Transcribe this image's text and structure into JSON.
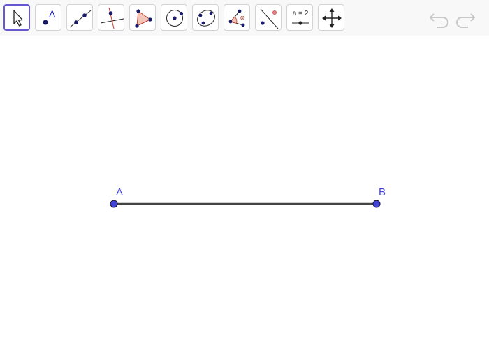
{
  "toolbar": {
    "tools": [
      {
        "name": "move-tool",
        "selected": true
      },
      {
        "name": "point-tool",
        "label": "A"
      },
      {
        "name": "line-tool"
      },
      {
        "name": "perpendicular-line-tool"
      },
      {
        "name": "polygon-tool"
      },
      {
        "name": "circle-center-point-tool"
      },
      {
        "name": "conic-five-points-tool"
      },
      {
        "name": "angle-tool",
        "label": "α"
      },
      {
        "name": "reflect-about-line-tool"
      },
      {
        "name": "slider-tool",
        "label": "a = 2"
      },
      {
        "name": "move-graphics-view-tool"
      }
    ],
    "undo_icon": "undo-icon",
    "redo_icon": "redo-icon"
  },
  "canvas": {
    "points": [
      {
        "name": "A",
        "label": "A"
      },
      {
        "name": "B",
        "label": "B"
      }
    ],
    "segment": {
      "from": "A",
      "to": "B"
    }
  },
  "colors": {
    "point": "#4343d8",
    "point_stroke": "#141428",
    "segment": "#444444",
    "selected_tool_border": "#6557d2",
    "tool_dark": "#1a1a6a",
    "polygon_fill": "#f2c5b8",
    "polygon_stroke": "#c0392b",
    "undo_redo": "#c8c8c8"
  }
}
